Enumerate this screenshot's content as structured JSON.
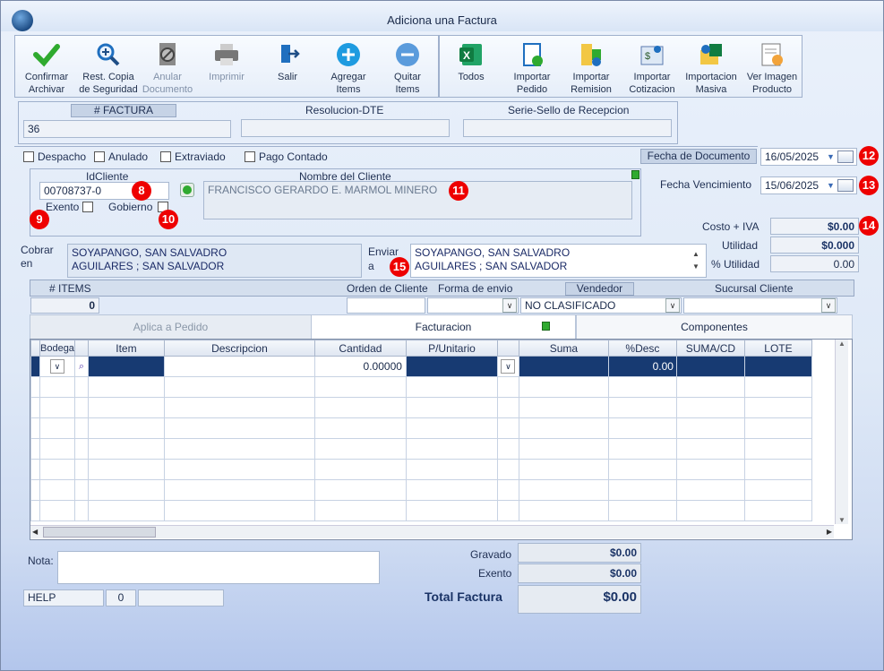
{
  "window": {
    "title": "Adiciona una Factura"
  },
  "toolbar": [
    {
      "label1": "Confirmar",
      "label2": "Archivar",
      "icon": "checkmark-icon",
      "enabled": true
    },
    {
      "label1": "Rest. Copia",
      "label2": "de Seguridad",
      "icon": "magnifier-plus-icon",
      "enabled": true
    },
    {
      "label1": "Anular",
      "label2": "Documento",
      "icon": "void-document-icon",
      "enabled": false
    },
    {
      "label1": "Imprimir",
      "label2": "",
      "icon": "printer-icon",
      "enabled": false
    },
    {
      "label1": "Salir",
      "label2": "",
      "icon": "exit-door-icon",
      "enabled": true
    },
    {
      "label1": "Agregar",
      "label2": "Items",
      "icon": "plus-circle-icon",
      "enabled": true
    },
    {
      "label1": "Quitar",
      "label2": "Items",
      "icon": "minus-circle-icon",
      "enabled": true
    },
    {
      "label1": "Todos",
      "label2": "",
      "icon": "excel-icon",
      "enabled": true
    },
    {
      "label1": "Importar",
      "label2": "Pedido",
      "icon": "import-order-icon",
      "enabled": true
    },
    {
      "label1": "Importar",
      "label2": "Remision",
      "icon": "import-remission-icon",
      "enabled": true
    },
    {
      "label1": "Importar",
      "label2": "Cotizacion",
      "icon": "import-quote-icon",
      "enabled": true
    },
    {
      "label1": "Importacion",
      "label2": "Masiva",
      "icon": "mass-import-icon",
      "enabled": true
    },
    {
      "label1": "Ver Imagen",
      "label2": "Producto",
      "icon": "product-image-icon",
      "enabled": true
    }
  ],
  "invoice": {
    "factura_label": "# FACTURA",
    "factura_value": "36",
    "resolucion_label": "Resolucion-DTE",
    "resolucion_value": "",
    "serie_label": "Serie-Sello de Recepcion",
    "serie_value": ""
  },
  "flags": {
    "despacho": "Despacho",
    "anulado": "Anulado",
    "extraviado": "Extraviado",
    "pago_contado": "Pago Contado"
  },
  "dates": {
    "fecha_documento_label": "Fecha de  Documento",
    "fecha_documento": "16/05/2025",
    "fecha_vencimiento_label": "Fecha Vencimiento",
    "fecha_vencimiento": "15/06/2025"
  },
  "client": {
    "id_label": "IdCliente",
    "id_value": "00708737-0",
    "name_label": "Nombre del Cliente",
    "name_value": "FRANCISCO GERARDO E. MARMOL MINERO",
    "exento_label": "Exento",
    "gobierno_label": "Gobierno"
  },
  "cobrar": {
    "label1": "Cobrar",
    "label2": "en",
    "line1": "SOYAPANGO, SAN SALVADRO",
    "line2": "AGUILARES ; SAN SALVADOR"
  },
  "enviar": {
    "label1": "Enviar",
    "label2": "a",
    "line1": "SOYAPANGO, SAN SALVADRO",
    "line2": "AGUILARES ; SAN SALVADOR"
  },
  "costs": {
    "costo_label": "Costo + IVA",
    "costo": "$0.00",
    "utilidad_label": "Utilidad",
    "utilidad": "$0.000",
    "pct_label": "% Utilidad",
    "pct": "0.00"
  },
  "meta": {
    "items_label": "# ITEMS",
    "items_value": "0",
    "orden_label": "Orden de Cliente",
    "forma_label": "Forma de envio",
    "vendedor_label": "Vendedor",
    "vendedor_value": "NO CLASIFICADO",
    "sucursal_label": "Sucursal Cliente"
  },
  "tabs": [
    "Aplica a Pedido",
    "Facturacion",
    "Componentes"
  ],
  "grid": {
    "columns": [
      "Bodega",
      "",
      "Item",
      "Descripcion",
      "Cantidad",
      "P/Unitario",
      "",
      "Suma",
      "%Desc",
      "SUMA/CD",
      "LOTE"
    ],
    "row": {
      "cantidad": "0.00000",
      "desc": "0.00"
    }
  },
  "footer": {
    "nota_label": "Nota:",
    "help": "HELP",
    "help_num": "0",
    "gravado_label": "Gravado",
    "gravado": "$0.00",
    "exento_label": "Exento",
    "exento": "$0.00",
    "total_label": "Total Factura",
    "total": "$0.00"
  },
  "markers": [
    "8",
    "9",
    "10",
    "11",
    "12",
    "13",
    "14",
    "15"
  ],
  "colors": {
    "accent": "#173a72",
    "marker": "#e00000",
    "header_bg": "#c6d3e6"
  }
}
